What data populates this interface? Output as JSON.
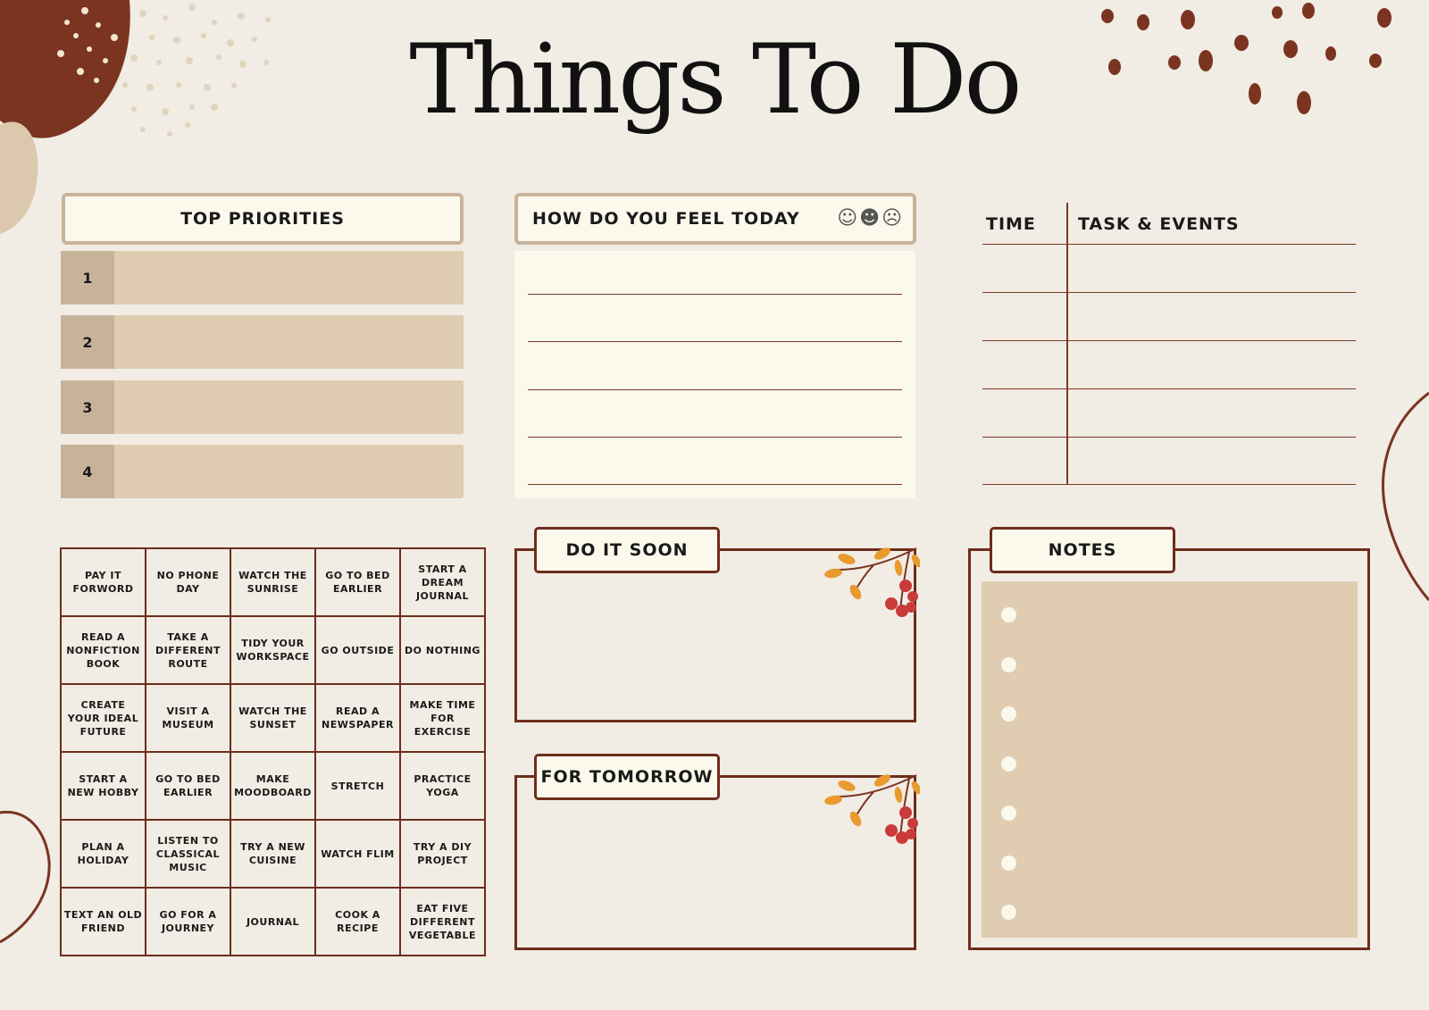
{
  "title": "Things To Do",
  "top_priorities": {
    "heading": "TOP PRIORITIES",
    "rows": [
      "1",
      "2",
      "3",
      "4"
    ]
  },
  "feel_today": {
    "heading": "HOW DO YOU FEEL TODAY",
    "moods": [
      "☺",
      "☻",
      "☹"
    ]
  },
  "schedule": {
    "time_heading": "TIME",
    "tasks_heading": "TASK & EVENTS"
  },
  "bingo": [
    [
      "PAY IT FORWORD",
      "NO PHONE DAY",
      "WATCH THE SUNRISE",
      "GO TO BED EARLIER",
      "START A DREAM JOURNAL"
    ],
    [
      "READ A NONFICTION BOOK",
      "TAKE A DIFFERENT ROUTE",
      "TIDY YOUR WORKSPACE",
      "GO OUTSIDE",
      "DO NOTHING"
    ],
    [
      "CREATE YOUR IDEAL FUTURE",
      "VISIT A MUSEUM",
      "WATCH THE SUNSET",
      "READ A NEWSPAPER",
      "MAKE TIME FOR EXERCISE"
    ],
    [
      "START A NEW HOBBY",
      "GO TO BED EARLIER",
      "MAKE MOODBOARD",
      "STRETCH",
      "PRACTICE YOGA"
    ],
    [
      "PLAN A HOLIDAY",
      "LISTEN TO CLASSICAL MUSIC",
      "TRY A NEW CUISINE",
      "WATCH FLIM",
      "TRY A DIY PROJECT"
    ],
    [
      "TEXT AN OLD FRIEND",
      "GO FOR A JOURNEY",
      "JOURNAL",
      "COOK A RECIPE",
      "EAT FIVE DIFFERENT VEGETABLE"
    ]
  ],
  "do_it_soon": {
    "heading": "DO IT SOON"
  },
  "for_tomorrow": {
    "heading": "FOR TOMORROW"
  },
  "notes": {
    "heading": "NOTES",
    "bullets": 7
  },
  "colors": {
    "background": "#f1ece4",
    "brown_dark": "#6d2d1c",
    "rust": "#7a3a24",
    "tan": "#dfccb1",
    "tan_dark": "#c7b39a",
    "cream": "#fbf8ec"
  }
}
